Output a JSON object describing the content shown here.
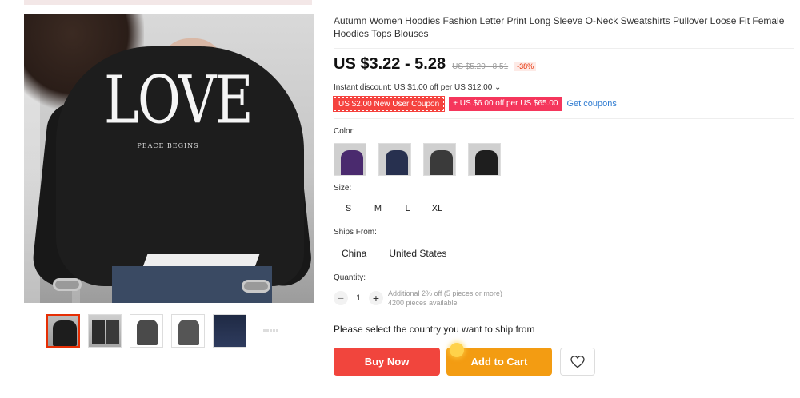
{
  "product": {
    "title": "Autumn Women Hoodies Fashion Letter Print Long Sleeve O-Neck Sweatshirts Pullover Loose Fit Female Hoodies Tops Blouses",
    "image_print_main": "LOVE",
    "image_print_sub": "PEACE BEGINS",
    "thumbnails": [
      "thumb-1",
      "thumb-2",
      "thumb-3",
      "thumb-4",
      "thumb-5",
      "thumb-6"
    ]
  },
  "pricing": {
    "price": "US $3.22 - 5.28",
    "original_price": "US $5.20 - 8.51",
    "discount": "-38%",
    "instant_discount": "Instant discount: US $1.00 off per US $12.00 ⌄",
    "coupon_new_user": "US $2.00 New User Coupon",
    "coupon_store": "+ US $6.00 off per US $65.00",
    "get_coupons": "Get coupons"
  },
  "options": {
    "color_label": "Color:",
    "colors": [
      "#4a2a6e",
      "#27304f",
      "#3a3a3a",
      "#1e1e1e"
    ],
    "size_label": "Size:",
    "sizes": [
      "S",
      "M",
      "L",
      "XL"
    ],
    "ships_from_label": "Ships From:",
    "ships_from": [
      "China",
      "United States"
    ]
  },
  "quantity": {
    "label": "Quantity:",
    "minus": "−",
    "value": "1",
    "plus": "+",
    "note_line1": "Additional 2% off (5 pieces or more)",
    "note_line2": "4200 pieces available"
  },
  "shipping_message": "Please select the country you want to ship from",
  "actions": {
    "buy_now": "Buy Now",
    "add_to_cart": "Add to Cart",
    "wishlist_icon": "heart-icon"
  },
  "colors": {
    "buy_button": "#f1453d",
    "cart_button": "#f39c12",
    "link": "#2e7bd1",
    "discount": "#e62e04"
  }
}
